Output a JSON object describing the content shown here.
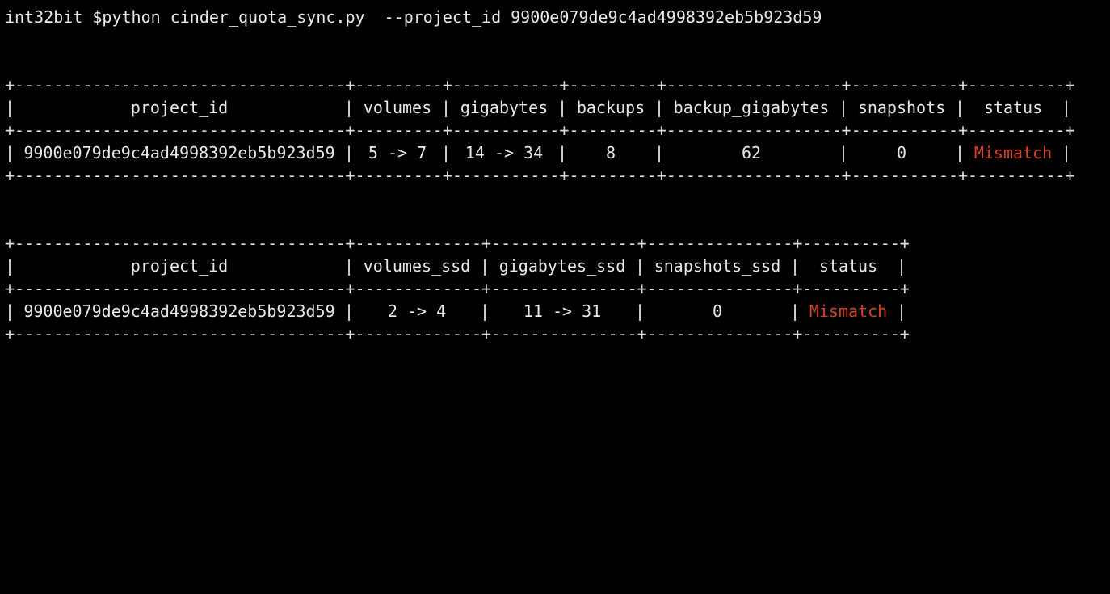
{
  "terminal": {
    "prompt": "int32bit $",
    "command": "python cinder_quota_sync.py  --project_id 9900e079de9c4ad4998392eb5b923d59"
  },
  "table1": {
    "headers": [
      "project_id",
      "volumes",
      "gigabytes",
      "backups",
      "backup_gigabytes",
      "snapshots",
      "status"
    ],
    "rows": [
      [
        "9900e079de9c4ad4998392eb5b923d59",
        "5 -> 7",
        "14 -> 34",
        "8",
        "62",
        "0",
        "Mismatch"
      ]
    ]
  },
  "table2": {
    "headers": [
      "project_id",
      "volumes_ssd",
      "gigabytes_ssd",
      "snapshots_ssd",
      "status"
    ],
    "rows": [
      [
        "9900e079de9c4ad4998392eb5b923d59",
        "2 -> 4",
        "11 -> 31",
        "0",
        "Mismatch"
      ]
    ]
  },
  "colors": {
    "background": "#000000",
    "text": "#e8e8e8",
    "mismatch": "#d9421f"
  }
}
